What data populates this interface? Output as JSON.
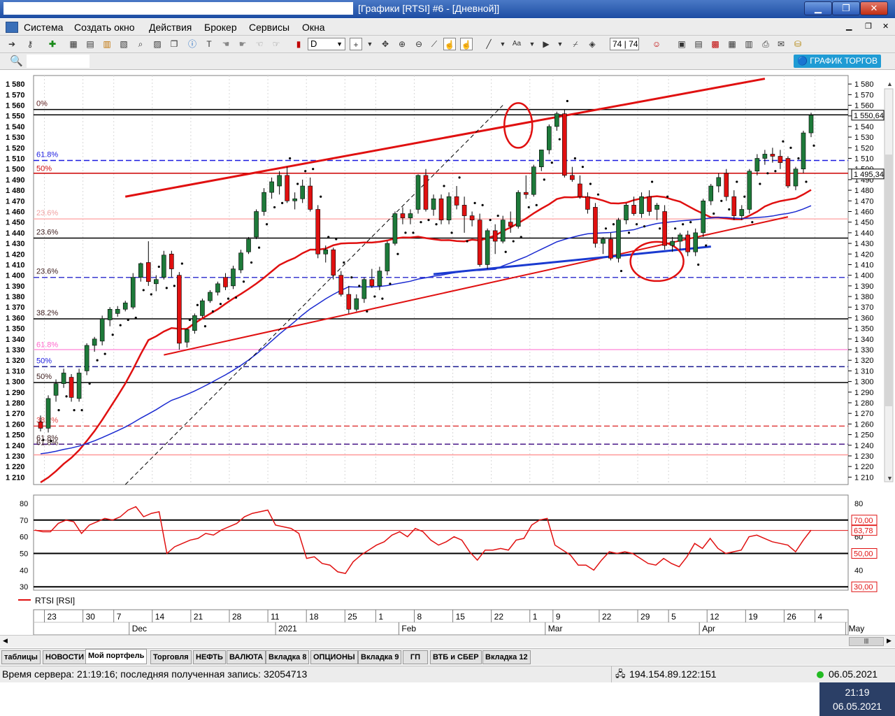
{
  "window": {
    "title": "[Графики [RTSI] #6 - [Дневной]]",
    "controls": [
      "▁",
      "❐",
      "✕"
    ]
  },
  "menu": [
    "Система",
    "Создать окно",
    "Действия",
    "Брокер",
    "Сервисы",
    "Окна"
  ],
  "mdi_controls": [
    "▁",
    "❐",
    "✕"
  ],
  "toolbar": {
    "period_value": "D",
    "line_width_value": "74 | 74"
  },
  "trade_button": "ГРАФИК ТОРГОВ",
  "price_axis": {
    "ticks": [
      "1 580",
      "1 570",
      "1 560",
      "1 550",
      "1 540",
      "1 530",
      "1 520",
      "1 510",
      "1 500",
      "1 490",
      "1 480",
      "1 470",
      "1 460",
      "1 450",
      "1 440",
      "1 430",
      "1 420",
      "1 410",
      "1 400",
      "1 390",
      "1 380",
      "1 370",
      "1 360",
      "1 350",
      "1 340",
      "1 330",
      "1 320",
      "1 310",
      "1 300",
      "1 290",
      "1 280",
      "1 270",
      "1 260",
      "1 250",
      "1 240",
      "1 230",
      "1 220",
      "1 210"
    ],
    "last_price_label": "1 550,64",
    "ma_label": "1 495,34"
  },
  "fib_labels": [
    {
      "text": "0%",
      "color": "#5a1a1a"
    },
    {
      "text": "61.8%",
      "color": "#1a1ae0"
    },
    {
      "text": "50%",
      "color": "#d01010"
    },
    {
      "text": "23.6%",
      "color": "#f0a0a0"
    },
    {
      "text": "23.6%",
      "color": "#3a1a1a"
    },
    {
      "text": "23.6%",
      "color": "#3a1a1a"
    },
    {
      "text": "38.2%",
      "color": "#3a1a1a"
    },
    {
      "text": "61.8%",
      "color": "#ff66cc"
    },
    {
      "text": "50%",
      "color": "#1a1ae0"
    },
    {
      "text": "50%",
      "color": "#3a1a1a"
    },
    {
      "text": "38.2%",
      "color": "#e04040"
    },
    {
      "text": "61.8%",
      "color": "#3a1a1a"
    },
    {
      "text": "61.8%",
      "color": "#3a1a1a"
    }
  ],
  "rsi": {
    "legend": "RTSI [RSI]",
    "ticks": [
      "80",
      "70",
      "60",
      "50",
      "40",
      "30"
    ],
    "labels": {
      "upper": "70,00",
      "current": "63,78",
      "mid": "50,00",
      "lower": "30,00"
    }
  },
  "chart_data": {
    "type": "candlestick",
    "symbol": "RTSI",
    "timeframe": "D",
    "ylim": [
      1203,
      1588
    ],
    "last_price": 1550.64,
    "ma_value": 1495.34,
    "candles": [
      {
        "o": 1262,
        "h": 1268,
        "l": 1253,
        "c": 1256
      },
      {
        "o": 1256,
        "h": 1287,
        "l": 1252,
        "c": 1284
      },
      {
        "o": 1287,
        "h": 1302,
        "l": 1281,
        "c": 1298
      },
      {
        "o": 1298,
        "h": 1312,
        "l": 1294,
        "c": 1308
      },
      {
        "o": 1304,
        "h": 1307,
        "l": 1281,
        "c": 1285
      },
      {
        "o": 1284,
        "h": 1312,
        "l": 1281,
        "c": 1308
      },
      {
        "o": 1310,
        "h": 1336,
        "l": 1306,
        "c": 1334
      },
      {
        "o": 1334,
        "h": 1342,
        "l": 1328,
        "c": 1340
      },
      {
        "o": 1338,
        "h": 1362,
        "l": 1334,
        "c": 1359
      },
      {
        "o": 1358,
        "h": 1370,
        "l": 1352,
        "c": 1368
      },
      {
        "o": 1364,
        "h": 1371,
        "l": 1361,
        "c": 1368
      },
      {
        "o": 1368,
        "h": 1376,
        "l": 1366,
        "c": 1374
      },
      {
        "o": 1370,
        "h": 1402,
        "l": 1368,
        "c": 1398
      },
      {
        "o": 1398,
        "h": 1412,
        "l": 1394,
        "c": 1411
      },
      {
        "o": 1412,
        "h": 1432,
        "l": 1390,
        "c": 1394
      },
      {
        "o": 1392,
        "h": 1400,
        "l": 1385,
        "c": 1396
      },
      {
        "o": 1398,
        "h": 1423,
        "l": 1396,
        "c": 1419
      },
      {
        "o": 1420,
        "h": 1423,
        "l": 1398,
        "c": 1406
      },
      {
        "o": 1400,
        "h": 1403,
        "l": 1330,
        "c": 1336
      },
      {
        "o": 1337,
        "h": 1350,
        "l": 1332,
        "c": 1349
      },
      {
        "o": 1348,
        "h": 1364,
        "l": 1345,
        "c": 1362
      },
      {
        "o": 1362,
        "h": 1378,
        "l": 1360,
        "c": 1376
      },
      {
        "o": 1376,
        "h": 1386,
        "l": 1374,
        "c": 1384
      },
      {
        "o": 1384,
        "h": 1394,
        "l": 1381,
        "c": 1392
      },
      {
        "o": 1398,
        "h": 1402,
        "l": 1386,
        "c": 1389
      },
      {
        "o": 1390,
        "h": 1409,
        "l": 1387,
        "c": 1406
      },
      {
        "o": 1405,
        "h": 1424,
        "l": 1402,
        "c": 1421
      },
      {
        "o": 1422,
        "h": 1436,
        "l": 1420,
        "c": 1434
      },
      {
        "o": 1436,
        "h": 1462,
        "l": 1434,
        "c": 1460
      },
      {
        "o": 1460,
        "h": 1482,
        "l": 1456,
        "c": 1478
      },
      {
        "o": 1478,
        "h": 1492,
        "l": 1472,
        "c": 1488
      },
      {
        "o": 1484,
        "h": 1498,
        "l": 1476,
        "c": 1494
      },
      {
        "o": 1494,
        "h": 1502,
        "l": 1468,
        "c": 1470
      },
      {
        "o": 1470,
        "h": 1478,
        "l": 1462,
        "c": 1472
      },
      {
        "o": 1472,
        "h": 1490,
        "l": 1468,
        "c": 1484
      },
      {
        "o": 1484,
        "h": 1492,
        "l": 1460,
        "c": 1462
      },
      {
        "o": 1462,
        "h": 1466,
        "l": 1416,
        "c": 1420
      },
      {
        "o": 1420,
        "h": 1428,
        "l": 1412,
        "c": 1424
      },
      {
        "o": 1424,
        "h": 1426,
        "l": 1396,
        "c": 1400
      },
      {
        "o": 1400,
        "h": 1404,
        "l": 1380,
        "c": 1382
      },
      {
        "o": 1382,
        "h": 1390,
        "l": 1364,
        "c": 1368
      },
      {
        "o": 1368,
        "h": 1382,
        "l": 1366,
        "c": 1378
      },
      {
        "o": 1378,
        "h": 1398,
        "l": 1374,
        "c": 1396
      },
      {
        "o": 1396,
        "h": 1406,
        "l": 1388,
        "c": 1390
      },
      {
        "o": 1390,
        "h": 1408,
        "l": 1386,
        "c": 1404
      },
      {
        "o": 1404,
        "h": 1432,
        "l": 1400,
        "c": 1430
      },
      {
        "o": 1430,
        "h": 1460,
        "l": 1428,
        "c": 1458
      },
      {
        "o": 1458,
        "h": 1464,
        "l": 1448,
        "c": 1454
      },
      {
        "o": 1454,
        "h": 1462,
        "l": 1448,
        "c": 1458
      },
      {
        "o": 1462,
        "h": 1495,
        "l": 1458,
        "c": 1494
      },
      {
        "o": 1494,
        "h": 1500,
        "l": 1460,
        "c": 1462
      },
      {
        "o": 1462,
        "h": 1476,
        "l": 1456,
        "c": 1472
      },
      {
        "o": 1472,
        "h": 1476,
        "l": 1448,
        "c": 1452
      },
      {
        "o": 1452,
        "h": 1478,
        "l": 1448,
        "c": 1474
      },
      {
        "o": 1474,
        "h": 1484,
        "l": 1462,
        "c": 1466
      },
      {
        "o": 1466,
        "h": 1474,
        "l": 1440,
        "c": 1456
      },
      {
        "o": 1456,
        "h": 1460,
        "l": 1446,
        "c": 1452
      },
      {
        "o": 1452,
        "h": 1458,
        "l": 1408,
        "c": 1410
      },
      {
        "o": 1410,
        "h": 1444,
        "l": 1406,
        "c": 1442
      },
      {
        "o": 1442,
        "h": 1448,
        "l": 1420,
        "c": 1432
      },
      {
        "o": 1432,
        "h": 1456,
        "l": 1430,
        "c": 1452
      },
      {
        "o": 1450,
        "h": 1460,
        "l": 1440,
        "c": 1446
      },
      {
        "o": 1446,
        "h": 1480,
        "l": 1444,
        "c": 1478
      },
      {
        "o": 1478,
        "h": 1494,
        "l": 1472,
        "c": 1476
      },
      {
        "o": 1476,
        "h": 1504,
        "l": 1474,
        "c": 1502
      },
      {
        "o": 1502,
        "h": 1518,
        "l": 1498,
        "c": 1518
      },
      {
        "o": 1518,
        "h": 1542,
        "l": 1514,
        "c": 1540
      },
      {
        "o": 1540,
        "h": 1554,
        "l": 1536,
        "c": 1552
      },
      {
        "o": 1552,
        "h": 1556,
        "l": 1492,
        "c": 1494
      },
      {
        "o": 1494,
        "h": 1502,
        "l": 1488,
        "c": 1490
      },
      {
        "o": 1486,
        "h": 1494,
        "l": 1472,
        "c": 1474
      },
      {
        "o": 1474,
        "h": 1478,
        "l": 1458,
        "c": 1462
      },
      {
        "o": 1464,
        "h": 1468,
        "l": 1426,
        "c": 1430
      },
      {
        "o": 1430,
        "h": 1436,
        "l": 1420,
        "c": 1434
      },
      {
        "o": 1434,
        "h": 1440,
        "l": 1414,
        "c": 1416
      },
      {
        "o": 1416,
        "h": 1454,
        "l": 1412,
        "c": 1452
      },
      {
        "o": 1452,
        "h": 1468,
        "l": 1448,
        "c": 1466
      },
      {
        "o": 1466,
        "h": 1474,
        "l": 1456,
        "c": 1458
      },
      {
        "o": 1458,
        "h": 1478,
        "l": 1454,
        "c": 1474
      },
      {
        "o": 1474,
        "h": 1480,
        "l": 1456,
        "c": 1460
      },
      {
        "o": 1462,
        "h": 1468,
        "l": 1452,
        "c": 1466
      },
      {
        "o": 1460,
        "h": 1466,
        "l": 1424,
        "c": 1428
      },
      {
        "o": 1428,
        "h": 1436,
        "l": 1422,
        "c": 1432
      },
      {
        "o": 1432,
        "h": 1440,
        "l": 1424,
        "c": 1438
      },
      {
        "o": 1438,
        "h": 1442,
        "l": 1418,
        "c": 1422
      },
      {
        "o": 1422,
        "h": 1444,
        "l": 1418,
        "c": 1440
      },
      {
        "o": 1440,
        "h": 1472,
        "l": 1436,
        "c": 1470
      },
      {
        "o": 1470,
        "h": 1486,
        "l": 1466,
        "c": 1484
      },
      {
        "o": 1484,
        "h": 1496,
        "l": 1478,
        "c": 1492
      },
      {
        "o": 1496,
        "h": 1500,
        "l": 1470,
        "c": 1474
      },
      {
        "o": 1474,
        "h": 1480,
        "l": 1452,
        "c": 1456
      },
      {
        "o": 1456,
        "h": 1466,
        "l": 1452,
        "c": 1462
      },
      {
        "o": 1462,
        "h": 1500,
        "l": 1458,
        "c": 1498
      },
      {
        "o": 1498,
        "h": 1514,
        "l": 1494,
        "c": 1510
      },
      {
        "o": 1510,
        "h": 1518,
        "l": 1504,
        "c": 1514
      },
      {
        "o": 1514,
        "h": 1520,
        "l": 1506,
        "c": 1512
      },
      {
        "o": 1512,
        "h": 1518,
        "l": 1500,
        "c": 1506
      },
      {
        "o": 1510,
        "h": 1512,
        "l": 1482,
        "c": 1484
      },
      {
        "o": 1484,
        "h": 1502,
        "l": 1480,
        "c": 1500
      },
      {
        "o": 1500,
        "h": 1536,
        "l": 1496,
        "c": 1534
      },
      {
        "o": 1534,
        "h": 1553,
        "l": 1530,
        "c": 1550.64
      }
    ],
    "rsi_series": [
      64,
      63,
      63,
      68,
      70,
      69,
      62,
      67,
      69,
      71,
      70,
      72,
      76,
      78,
      72,
      74,
      75,
      50,
      54,
      56,
      58,
      59,
      62,
      61,
      64,
      66,
      68,
      72,
      74,
      75,
      76,
      67,
      66,
      65,
      62,
      47,
      48,
      44,
      43,
      39,
      38,
      45,
      49,
      52,
      55,
      57,
      61,
      63,
      60,
      65,
      63,
      58,
      55,
      57,
      60,
      58,
      51,
      46,
      52,
      52,
      53,
      52,
      58,
      59,
      67,
      70,
      71,
      55,
      52,
      49,
      43,
      43,
      40,
      46,
      51,
      50,
      51,
      50,
      47,
      44,
      43,
      47,
      44,
      42,
      48,
      56,
      53,
      59,
      53,
      50,
      51,
      52,
      60,
      61,
      59,
      57,
      56,
      55,
      51,
      58,
      64
    ],
    "rsi_last": 63.78,
    "x_month_labels": [
      {
        "i": 12,
        "text": "Dec"
      },
      {
        "i": 31,
        "text": "2021"
      },
      {
        "i": 47,
        "text": "Feb"
      },
      {
        "i": 66,
        "text": "Mar"
      },
      {
        "i": 86,
        "text": "Apr"
      },
      {
        "i": 105,
        "text": "May"
      }
    ],
    "x_day_labels": [
      {
        "i": 1,
        "text": "23"
      },
      {
        "i": 6,
        "text": "30"
      },
      {
        "i": 10,
        "text": "7"
      },
      {
        "i": 15,
        "text": "14"
      },
      {
        "i": 20,
        "text": "21"
      },
      {
        "i": 25,
        "text": "28"
      },
      {
        "i": 30,
        "text": "11"
      },
      {
        "i": 35,
        "text": "18"
      },
      {
        "i": 40,
        "text": "25"
      },
      {
        "i": 44,
        "text": "1"
      },
      {
        "i": 49,
        "text": "8"
      },
      {
        "i": 54,
        "text": "15"
      },
      {
        "i": 59,
        "text": "22"
      },
      {
        "i": 64,
        "text": "1"
      },
      {
        "i": 67,
        "text": "9"
      },
      {
        "i": 73,
        "text": "22"
      },
      {
        "i": 78,
        "text": "29"
      },
      {
        "i": 82,
        "text": "5"
      },
      {
        "i": 87,
        "text": "12"
      },
      {
        "i": 92,
        "text": "19"
      },
      {
        "i": 97,
        "text": "26"
      },
      {
        "i": 101,
        "text": "4"
      }
    ],
    "horizontal_lines": [
      {
        "price": 1556,
        "color": "#000000",
        "style": "solid"
      },
      {
        "price": 1551,
        "color": "#000000",
        "style": "solid"
      },
      {
        "price": 1508,
        "color": "#1a1ae0",
        "style": "dash"
      },
      {
        "price": 1496,
        "color": "#cc0000",
        "style": "solid"
      },
      {
        "price": 1453,
        "color": "#ffb0b0",
        "style": "solid"
      },
      {
        "price": 1435,
        "color": "#000000",
        "style": "solid"
      },
      {
        "price": 1398,
        "color": "#3a3ad0",
        "style": "dash"
      },
      {
        "price": 1359,
        "color": "#000000",
        "style": "solid"
      },
      {
        "price": 1330,
        "color": "#ff99dd",
        "style": "solid"
      },
      {
        "price": 1314,
        "color": "#1a1a90",
        "style": "dash"
      },
      {
        "price": 1299,
        "color": "#000000",
        "style": "solid"
      },
      {
        "price": 1258,
        "color": "#e04040",
        "style": "dash"
      },
      {
        "price": 1241,
        "color": "#4a1a8a",
        "style": "dash"
      },
      {
        "price": 1231,
        "color": "#ff9999",
        "style": "solid"
      }
    ]
  },
  "tabs": [
    "таблицы",
    "НОВОСТИ",
    "Мой портфель",
    "Торговля",
    "НЕФТЬ",
    "ВАЛЮТА",
    "Вкладка 8",
    "ОПЦИОНЫ",
    "Вкладка 9",
    "ГП",
    "ВТБ и СБЕР",
    "Вкладка 12"
  ],
  "status": {
    "server_text": "Время сервера: 21:19:16; последняя полученная запись: 32054713",
    "ip": "194.154.89.122:151",
    "date": "06.05.2021"
  },
  "clock": {
    "time": "21:19",
    "date": "06.05.2021"
  }
}
